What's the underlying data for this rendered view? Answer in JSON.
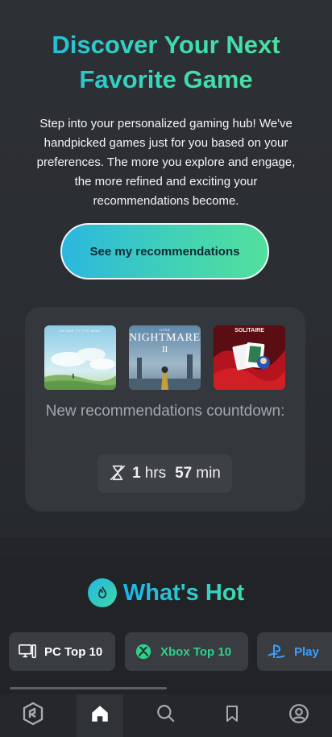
{
  "hero": {
    "title": "Discover Your Next Favorite Game",
    "description": "Step into your personalized gaming hub! We've handpicked games just for you based on your preferences. The more you explore and engage, the more refined and exciting your recommendations become.",
    "cta_label": "See my recommendations"
  },
  "recommendations": {
    "thumbnails": [
      {
        "name": "sky-landscape-game-thumbnail",
        "caption": "AN ODE TO THE WIND"
      },
      {
        "name": "little-nightmares-ii-thumbnail",
        "caption_small": "LITTLE",
        "caption": "NIGHTMARES",
        "caption_sub": "II"
      },
      {
        "name": "solitaire-cards-thumbnail",
        "caption": "SOLITAIRE"
      }
    ],
    "countdown_label": "New recommendations countdown:",
    "hours_value": "1",
    "hours_unit": "hrs",
    "minutes_value": "57",
    "minutes_unit": "min"
  },
  "whats_hot": {
    "title": "What's Hot",
    "chips": [
      {
        "label": "PC Top 10",
        "icon": "pc-icon"
      },
      {
        "label": "Xbox Top 10",
        "icon": "xbox-icon"
      },
      {
        "label": "Play",
        "icon": "playstation-icon"
      }
    ]
  },
  "bottom_nav": {
    "items": [
      "app-logo-icon",
      "home-icon",
      "search-icon",
      "bookmark-icon",
      "profile-icon"
    ],
    "active": "home-icon"
  },
  "colors": {
    "accent_gradient_start": "#1bb6ea",
    "accent_gradient_end": "#52e09c",
    "xbox_green": "#2fd08c",
    "background": "#232529"
  }
}
